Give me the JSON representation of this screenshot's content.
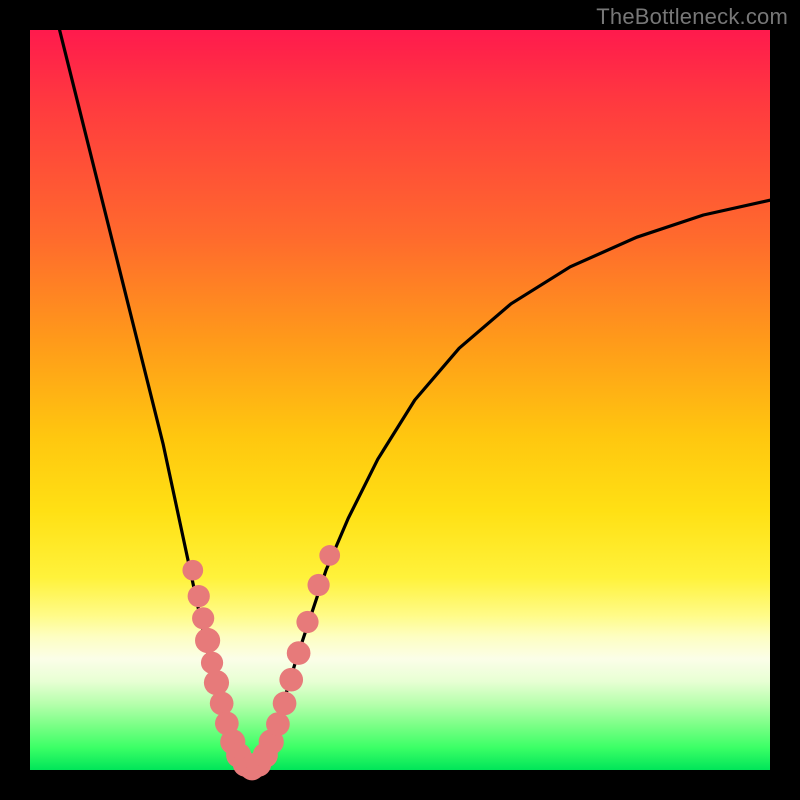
{
  "watermark": "TheBottleneck.com",
  "chart_data": {
    "type": "line",
    "title": "",
    "xlabel": "",
    "ylabel": "",
    "xlim": [
      0,
      100
    ],
    "ylim": [
      0,
      100
    ],
    "grid": false,
    "legend": false,
    "curve_points": [
      {
        "x": 4,
        "y": 100
      },
      {
        "x": 6,
        "y": 92
      },
      {
        "x": 8,
        "y": 84
      },
      {
        "x": 10,
        "y": 76
      },
      {
        "x": 12,
        "y": 68
      },
      {
        "x": 14,
        "y": 60
      },
      {
        "x": 16,
        "y": 52
      },
      {
        "x": 18,
        "y": 44
      },
      {
        "x": 19.5,
        "y": 37
      },
      {
        "x": 21,
        "y": 30
      },
      {
        "x": 22.5,
        "y": 23
      },
      {
        "x": 24,
        "y": 16
      },
      {
        "x": 25.5,
        "y": 10
      },
      {
        "x": 27,
        "y": 5
      },
      {
        "x": 28.5,
        "y": 1.5
      },
      {
        "x": 30,
        "y": 0
      },
      {
        "x": 31.5,
        "y": 1.5
      },
      {
        "x": 33,
        "y": 5
      },
      {
        "x": 34.5,
        "y": 10
      },
      {
        "x": 36,
        "y": 15
      },
      {
        "x": 38,
        "y": 21
      },
      {
        "x": 40,
        "y": 27
      },
      {
        "x": 43,
        "y": 34
      },
      {
        "x": 47,
        "y": 42
      },
      {
        "x": 52,
        "y": 50
      },
      {
        "x": 58,
        "y": 57
      },
      {
        "x": 65,
        "y": 63
      },
      {
        "x": 73,
        "y": 68
      },
      {
        "x": 82,
        "y": 72
      },
      {
        "x": 91,
        "y": 75
      },
      {
        "x": 100,
        "y": 77
      }
    ],
    "markers": [
      {
        "x": 22.0,
        "y": 27.0,
        "r": 1.4
      },
      {
        "x": 22.8,
        "y": 23.5,
        "r": 1.5
      },
      {
        "x": 23.4,
        "y": 20.5,
        "r": 1.5
      },
      {
        "x": 24.0,
        "y": 17.5,
        "r": 1.7
      },
      {
        "x": 24.6,
        "y": 14.5,
        "r": 1.5
      },
      {
        "x": 25.2,
        "y": 11.8,
        "r": 1.7
      },
      {
        "x": 25.9,
        "y": 9.0,
        "r": 1.6
      },
      {
        "x": 26.6,
        "y": 6.3,
        "r": 1.6
      },
      {
        "x": 27.4,
        "y": 3.8,
        "r": 1.7
      },
      {
        "x": 28.2,
        "y": 2.0,
        "r": 1.7
      },
      {
        "x": 29.1,
        "y": 0.8,
        "r": 1.7
      },
      {
        "x": 30.0,
        "y": 0.3,
        "r": 1.7
      },
      {
        "x": 30.9,
        "y": 0.8,
        "r": 1.7
      },
      {
        "x": 31.8,
        "y": 2.0,
        "r": 1.7
      },
      {
        "x": 32.6,
        "y": 3.8,
        "r": 1.7
      },
      {
        "x": 33.5,
        "y": 6.2,
        "r": 1.6
      },
      {
        "x": 34.4,
        "y": 9.0,
        "r": 1.6
      },
      {
        "x": 35.3,
        "y": 12.2,
        "r": 1.6
      },
      {
        "x": 36.3,
        "y": 15.8,
        "r": 1.6
      },
      {
        "x": 37.5,
        "y": 20.0,
        "r": 1.5
      },
      {
        "x": 39.0,
        "y": 25.0,
        "r": 1.5
      },
      {
        "x": 40.5,
        "y": 29.0,
        "r": 1.4
      }
    ],
    "background_gradient_note": "vertical red-to-green percent scale, green=0, red=100"
  }
}
